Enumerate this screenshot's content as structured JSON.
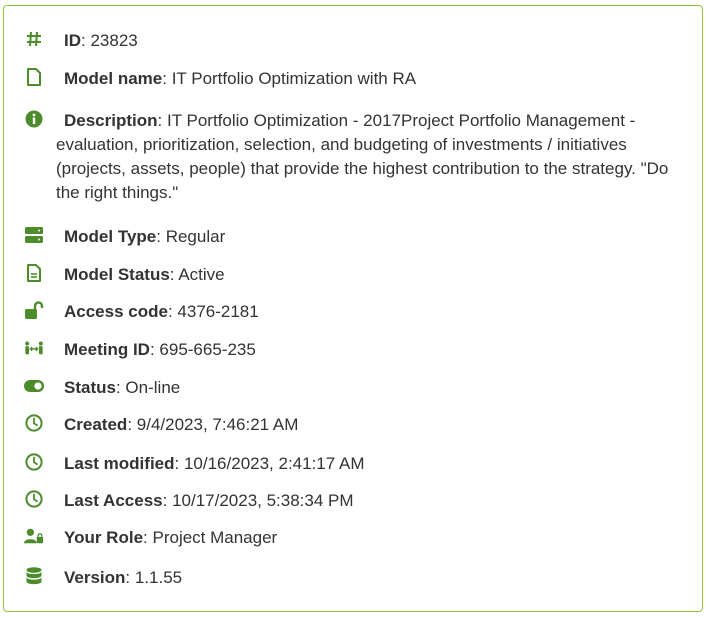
{
  "accent_color": "#4c8c2b",
  "border_color": "#8cc63f",
  "fields": [
    {
      "key": "id",
      "icon": "hash-icon",
      "label": "ID",
      "value": "23823"
    },
    {
      "key": "model_name",
      "icon": "file-icon",
      "label": "Model name",
      "value": "IT Portfolio Optimization with RA"
    },
    {
      "key": "description",
      "icon": "info-circle-icon",
      "label": "Description",
      "value": "IT Portfolio Optimization - 2017Project Portfolio Management - evaluation, prioritization, selection, and budgeting of investments / initiatives (projects, assets, people) that provide the highest contribution to the strategy. \"Do the right things.\""
    },
    {
      "key": "model_type",
      "icon": "server-icon",
      "label": "Model Type",
      "value": "Regular"
    },
    {
      "key": "model_status",
      "icon": "file-text-icon",
      "label": "Model Status",
      "value": "Active"
    },
    {
      "key": "access_code",
      "icon": "unlock-icon",
      "label": "Access code",
      "value": "4376-2181"
    },
    {
      "key": "meeting_id",
      "icon": "people-arrows-icon",
      "label": "Meeting ID",
      "value": "695-665-235"
    },
    {
      "key": "status",
      "icon": "toggle-on-icon",
      "label": "Status",
      "value": "On-line"
    },
    {
      "key": "created",
      "icon": "clock-icon",
      "label": "Created",
      "value": "9/4/2023, 7:46:21 AM"
    },
    {
      "key": "last_modified",
      "icon": "clock-icon",
      "label": "Last modified",
      "value": "10/16/2023, 2:41:17 AM"
    },
    {
      "key": "last_access",
      "icon": "clock-icon",
      "label": "Last Access",
      "value": "10/17/2023, 5:38:34 PM"
    },
    {
      "key": "your_role",
      "icon": "user-lock-icon",
      "label": "Your Role",
      "value": "Project Manager"
    },
    {
      "key": "version",
      "icon": "database-icon",
      "label": "Version",
      "value": "1.1.55"
    }
  ]
}
